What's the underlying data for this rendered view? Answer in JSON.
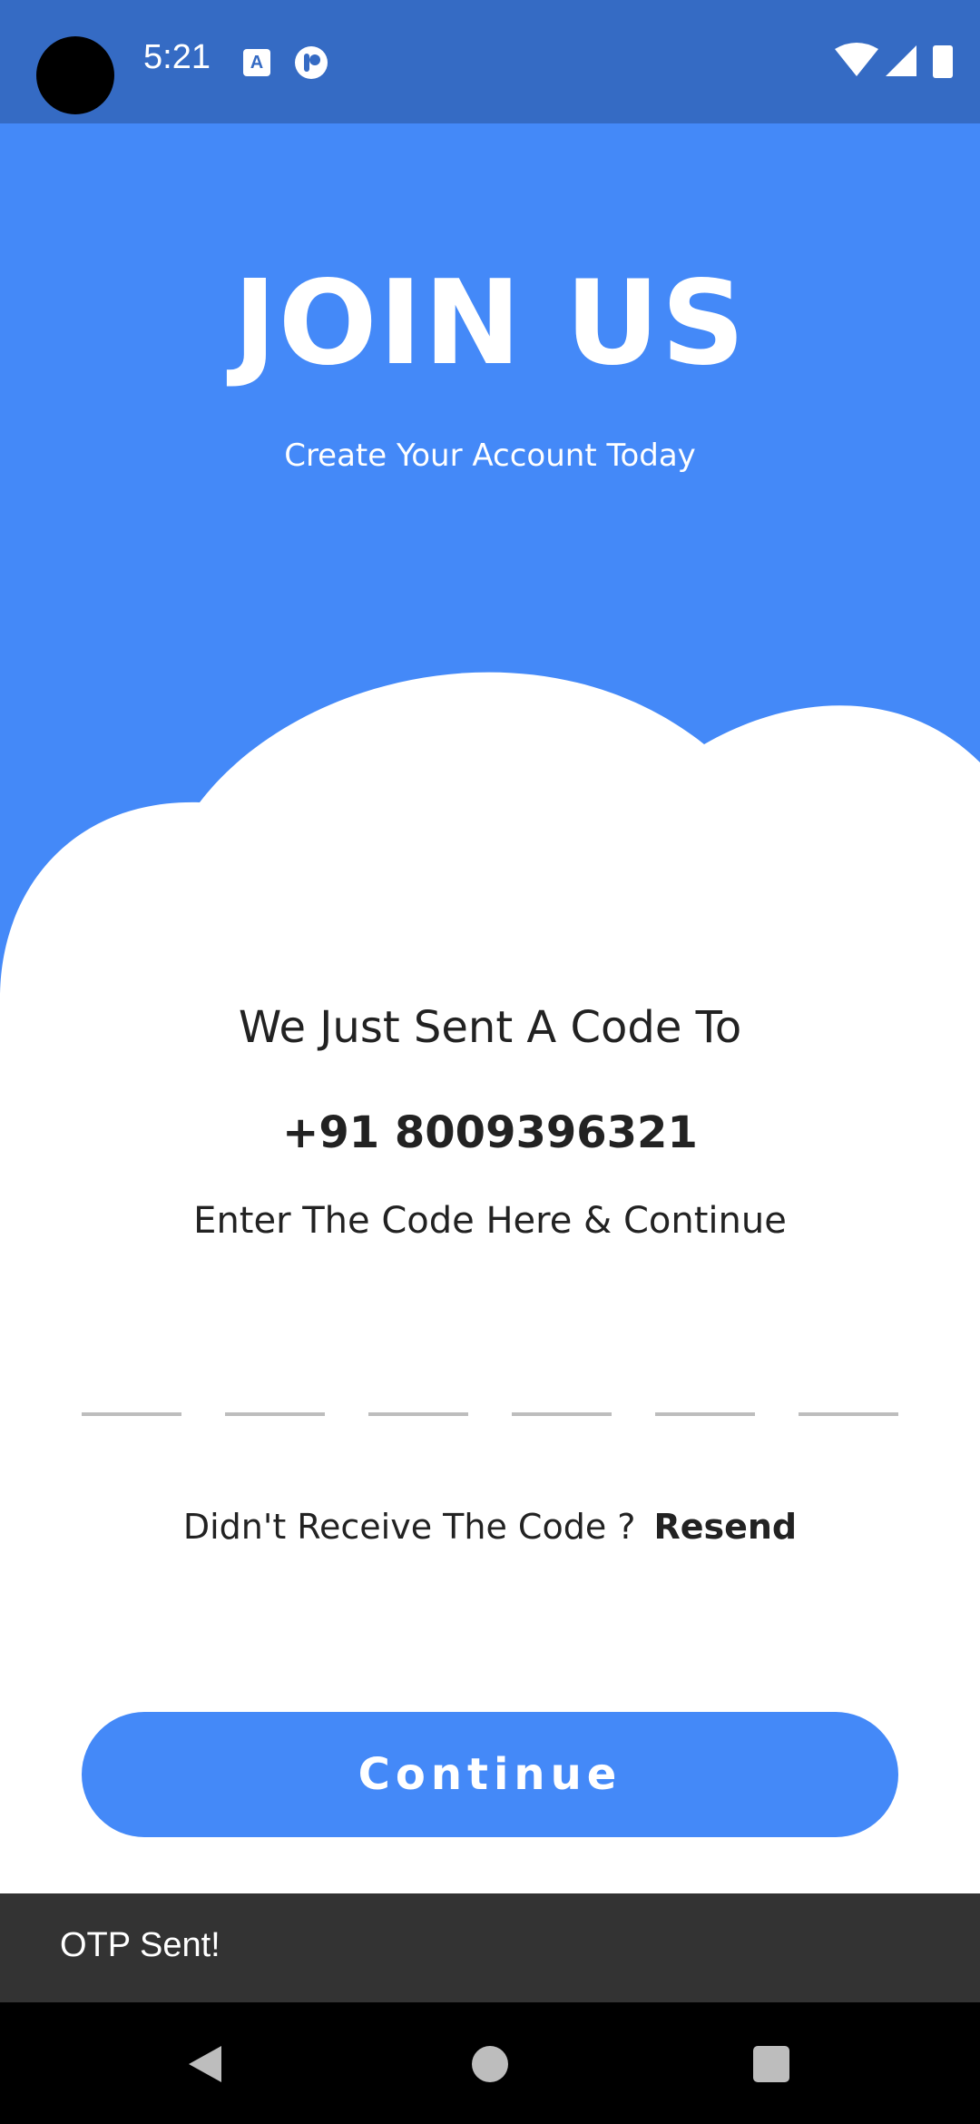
{
  "status_bar": {
    "time": "5:21",
    "notification_icons": [
      "text-format-icon",
      "pinterest-like-icon"
    ],
    "system_icons": [
      "wifi-icon",
      "cellular-signal-icon",
      "battery-icon"
    ]
  },
  "header": {
    "title": "JOIN US",
    "subtitle": "Create Your Account Today"
  },
  "verification": {
    "sent_text": "We Just Sent A Code To",
    "phone_number": "+91 8009396321",
    "instruction": "Enter The Code Here & Continue",
    "otp_digits": [
      "",
      "",
      "",
      "",
      "",
      ""
    ]
  },
  "resend": {
    "question": "Didn't Receive The Code ?",
    "link_label": "Resend"
  },
  "continue_button": {
    "label": "Continue"
  },
  "snackbar": {
    "message": "OTP Sent!"
  },
  "navigation_bar": {
    "icons": [
      "back-icon",
      "home-icon",
      "recents-icon"
    ]
  },
  "colors": {
    "status_bar": "#356BC4",
    "primary": "#4489F8",
    "snackbar": "#333333"
  }
}
